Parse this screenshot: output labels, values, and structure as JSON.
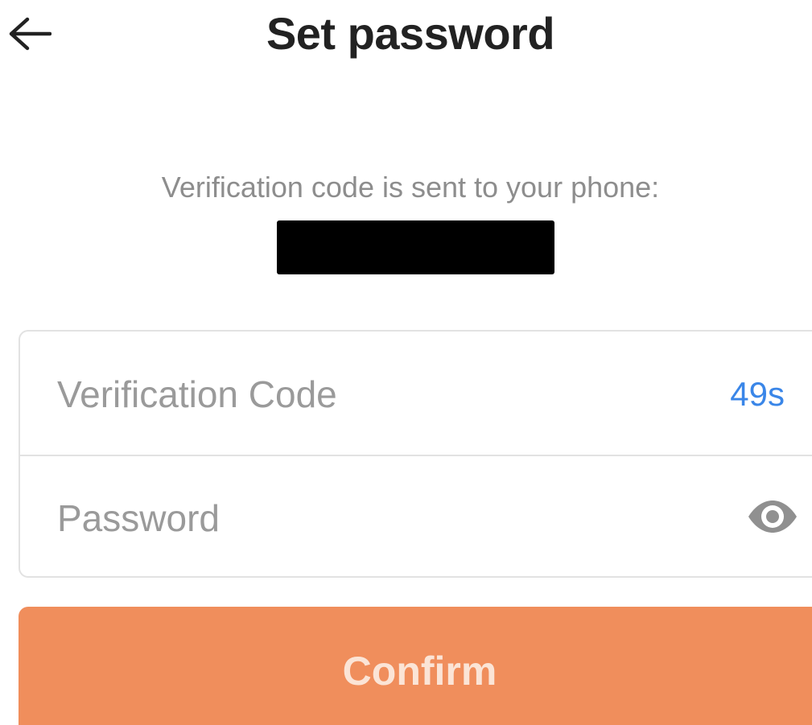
{
  "header": {
    "back_icon": "arrow-left-icon",
    "title": "Set password"
  },
  "verification": {
    "sent_message": "Verification code is sent to your phone:"
  },
  "form": {
    "code_placeholder": "Verification Code",
    "countdown": "49s",
    "password_placeholder": "Password",
    "eye_icon": "eye-icon"
  },
  "actions": {
    "confirm_label": "Confirm"
  },
  "colors": {
    "accent_button": "#f08e5c",
    "countdown_link": "#3a86e8",
    "title_text": "#222222",
    "muted_text": "#8d8d8d"
  }
}
